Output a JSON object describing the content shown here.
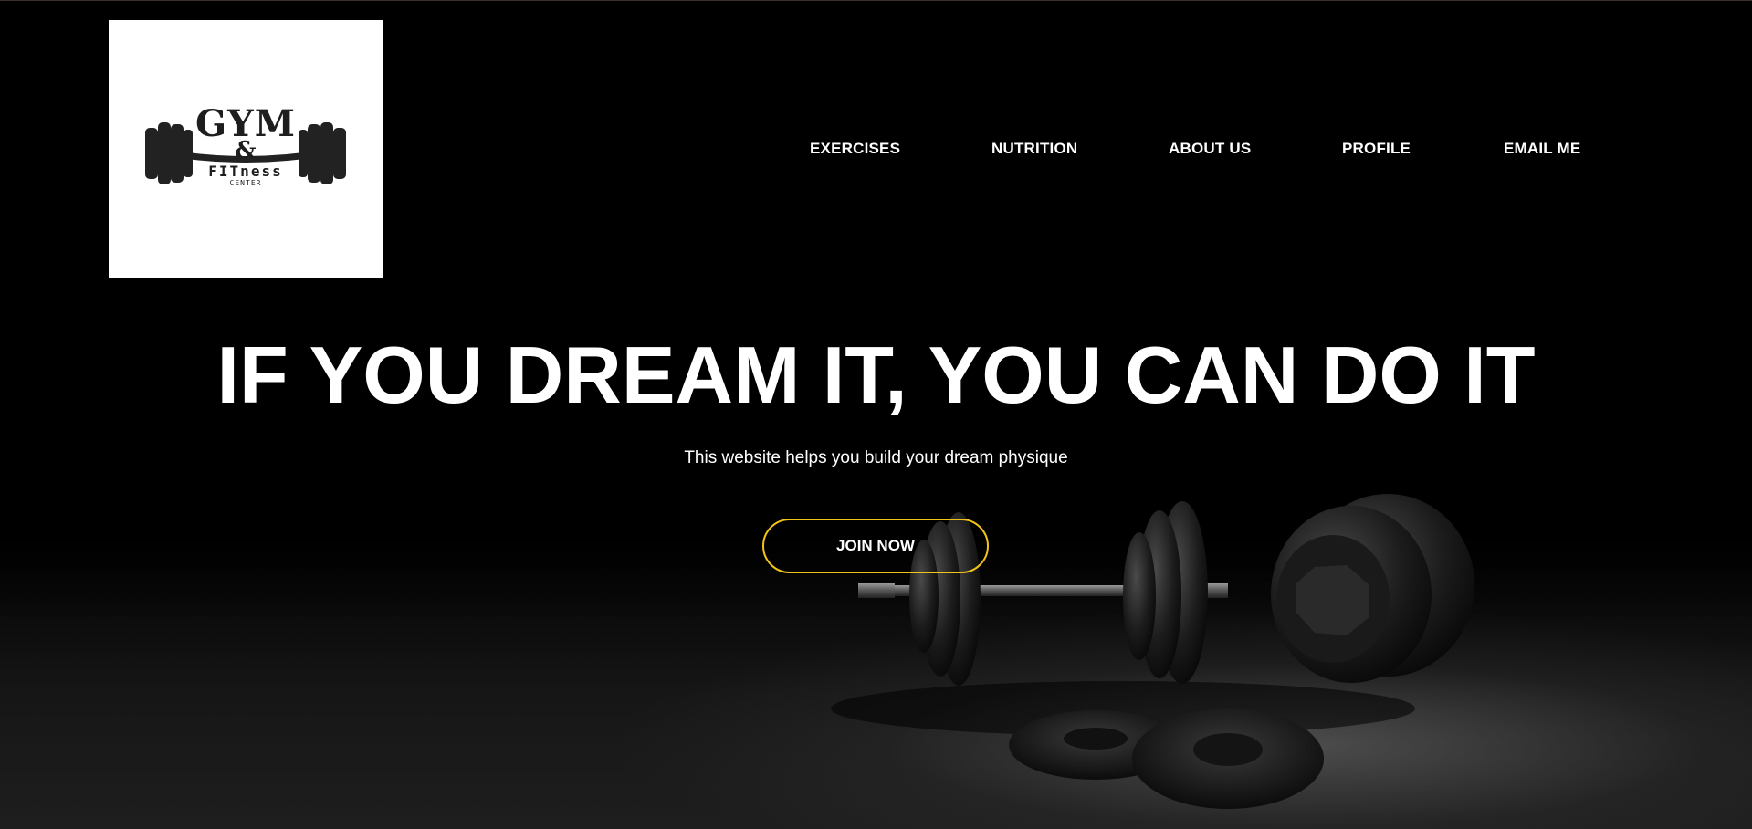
{
  "logo": {
    "line1": "GYM",
    "line2": "&",
    "line3": "FITness",
    "line4": "CENTER"
  },
  "nav": {
    "items": [
      {
        "label": "EXERCISES"
      },
      {
        "label": "NUTRITION"
      },
      {
        "label": "ABOUT US"
      },
      {
        "label": "PROFILE"
      },
      {
        "label": "EMAIL ME"
      }
    ]
  },
  "hero": {
    "title": "IF YOU DREAM IT, YOU CAN DO IT",
    "subtitle": "This website helps you build your dream physique",
    "cta_label": "JOIN NOW"
  },
  "colors": {
    "background": "#000000",
    "text": "#ffffff",
    "cta_border": "#f0c419"
  },
  "icons": {
    "logo_emblem": "barbell-icon",
    "background_image": "dumbbells-illustration"
  }
}
